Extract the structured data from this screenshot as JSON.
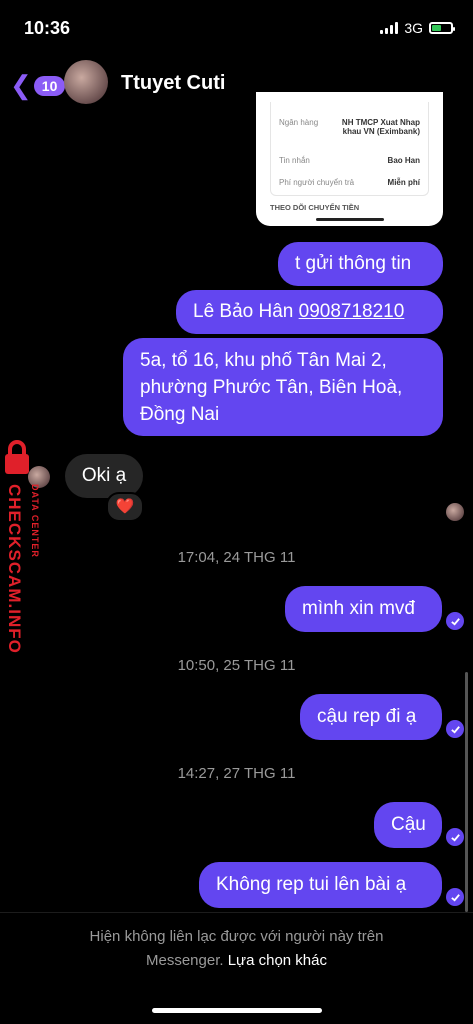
{
  "status_bar": {
    "time": "10:36",
    "network": "3G"
  },
  "header": {
    "back_count": "10",
    "contact_name": "Ttuyet Cuti"
  },
  "shared_card": {
    "rows": [
      {
        "key": "Ngân hàng",
        "value": "NH TMCP Xuat Nhap khau VN (Eximbank)"
      },
      {
        "key": "Tin nhắn",
        "value": "Bao Han"
      },
      {
        "key": "Phí người chuyển trả",
        "value": "Miễn phí"
      }
    ],
    "tracking_label": "THEO DÕI CHUYỂN TIỀN"
  },
  "messages": {
    "m1": "t gửi thông tin",
    "m2_name": "Lê Bảo Hân ",
    "m2_phone": "0908718210",
    "m3_l1": "5a, tổ 16, khu phố Tân Mai 2,",
    "m3_l2": "phường Phước Tân, Biên Hoà,",
    "m3_l3": "Đồng Nai",
    "in1": "Oki ạ",
    "reaction": "❤️",
    "ts1": "17:04, 24 THG 11",
    "m4": "mình xin mvđ",
    "ts2": "10:50, 25 THG 11",
    "m5": "cậu rep đi ạ",
    "ts3": "14:27, 27 THG 11",
    "m6": "Cậu",
    "m7": "Không rep tui lên bài ạ"
  },
  "watermark": {
    "brand": "CHECKSCAM.INFO",
    "sub": "DATA CENTER"
  },
  "footer": {
    "line1": "Hiện không liên lạc được với người này trên",
    "line2_prefix": "Messenger. ",
    "line2_link": "Lựa chọn khác"
  },
  "colors": {
    "accent": "#6346f0",
    "back": "#8b5cf6",
    "watermark": "#e0202a"
  }
}
